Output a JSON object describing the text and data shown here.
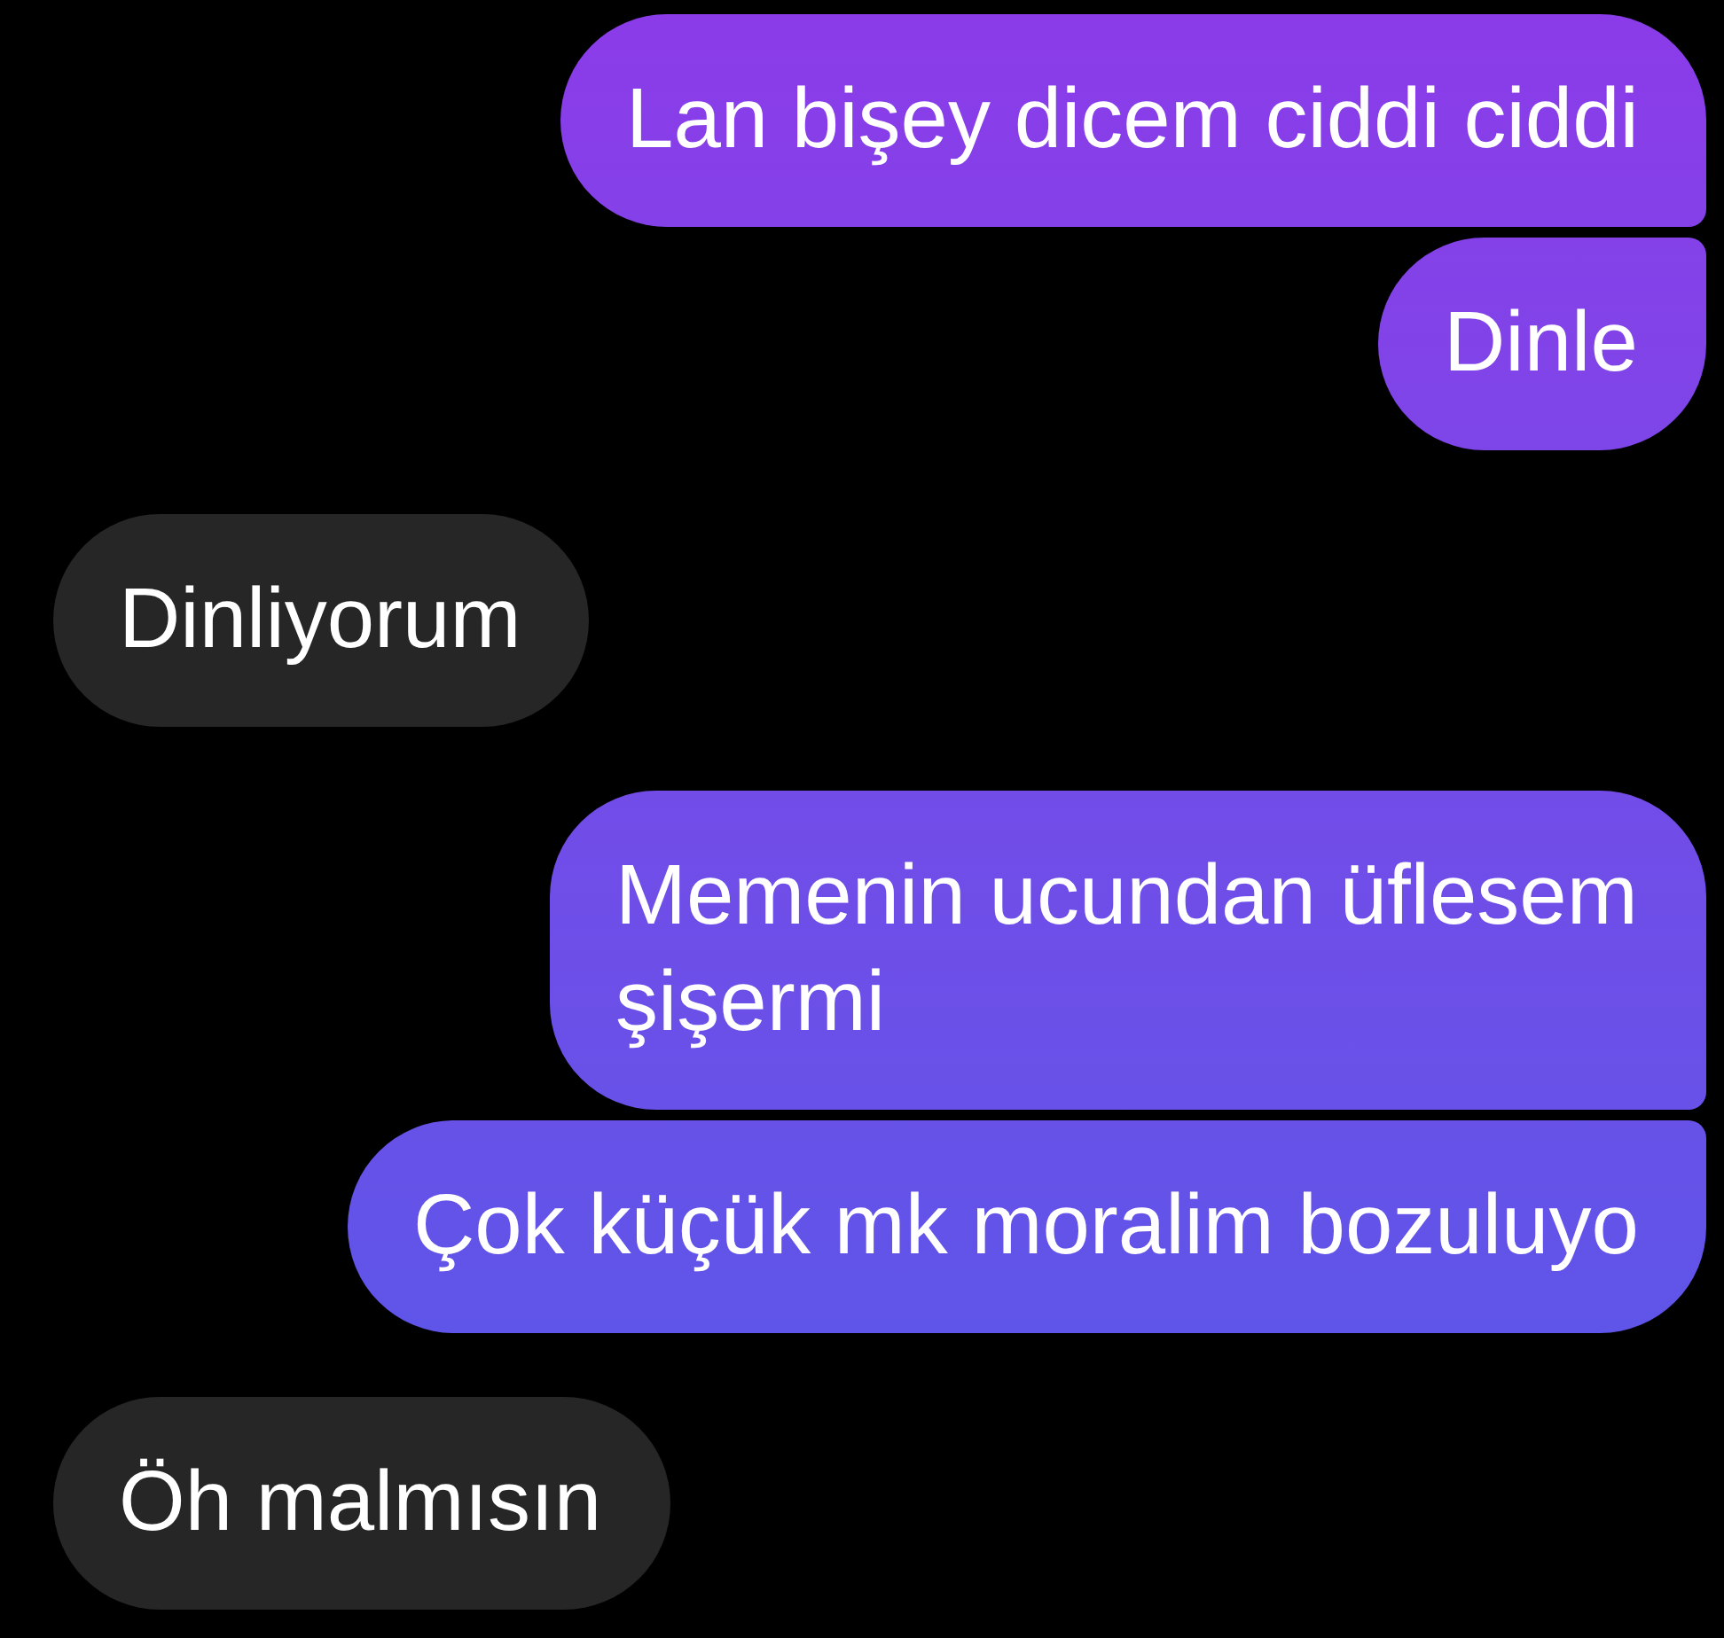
{
  "messages": [
    {
      "kind": "sent",
      "text": "Lan bişey dicem ciddi ciddi"
    },
    {
      "kind": "sent",
      "text": "Dinle"
    },
    {
      "kind": "received",
      "text": "Dinliyorum"
    },
    {
      "kind": "sent",
      "text": "Memenin ucundan üflesem şişermi"
    },
    {
      "kind": "sent",
      "text": "Çok küçük mk moralim bozuluyo"
    },
    {
      "kind": "received",
      "text": "Öh malmısın"
    }
  ]
}
